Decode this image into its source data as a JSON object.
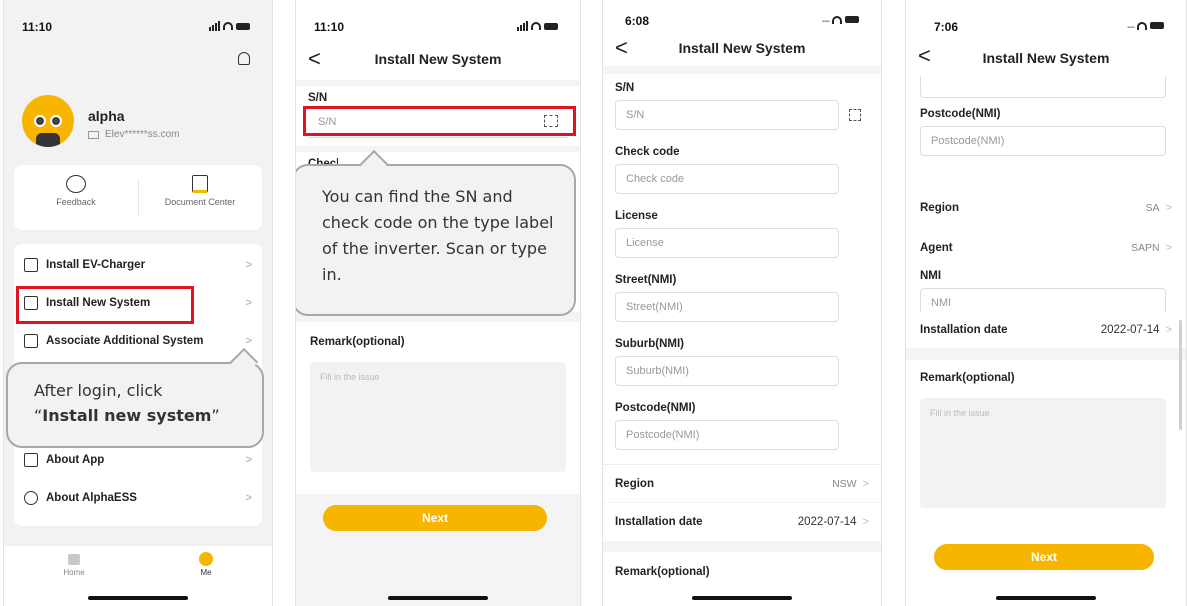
{
  "p1": {
    "time": "11:10",
    "username": "alpha",
    "email": "Elev******ss.com",
    "feedback": "Feedback",
    "document_center": "Document Center",
    "menu": [
      {
        "label": "Install EV-Charger"
      },
      {
        "label": "Install New System"
      },
      {
        "label": "Associate Additional System"
      },
      {
        "label": "About App"
      },
      {
        "label": "About AlphaESS"
      }
    ],
    "callout_line1": "After login, click",
    "callout_quote_open": "“",
    "callout_bold": "Install new system",
    "callout_quote_close": "”",
    "tab_home": "Home",
    "tab_me": "Me"
  },
  "p2": {
    "time": "11:10",
    "title": "Install New System",
    "sn_label": "S/N",
    "sn_placeholder": "S/N",
    "check_label": "Check code",
    "callout": "You can find the SN  and check code on the type label of the inverter. Scan or type in.",
    "remark_label": "Remark(optional)",
    "remark_placeholder": "Fill in the issue",
    "next": "Next"
  },
  "p3": {
    "time": "6:08",
    "title": "Install New System",
    "fields": [
      {
        "label": "S/N",
        "placeholder": "S/N"
      },
      {
        "label": "Check code",
        "placeholder": "Check code"
      },
      {
        "label": "License",
        "placeholder": "License"
      },
      {
        "label": "Street(NMI)",
        "placeholder": "Street(NMI)"
      },
      {
        "label": "Suburb(NMI)",
        "placeholder": "Suburb(NMI)"
      },
      {
        "label": "Postcode(NMI)",
        "placeholder": "Postcode(NMI)"
      }
    ],
    "region_label": "Region",
    "region_value": "NSW",
    "date_label": "Installation date",
    "date_value": "2022-07-14",
    "remark_label": "Remark(optional)"
  },
  "p4": {
    "time": "7:06",
    "title": "Install New System",
    "postcode_label": "Postcode(NMI)",
    "postcode_placeholder": "Postcode(NMI)",
    "region_label": "Region",
    "region_value": "SA",
    "agent_label": "Agent",
    "agent_value": "SAPN",
    "nmi_label": "NMI",
    "nmi_placeholder": "NMI",
    "date_label": "Installation date",
    "date_value": "2022-07-14",
    "remark_label": "Remark(optional)",
    "remark_placeholder": "Fill in the issue",
    "next": "Next"
  },
  "colors": {
    "accent": "#f7b500",
    "highlight": "#e0141e"
  }
}
